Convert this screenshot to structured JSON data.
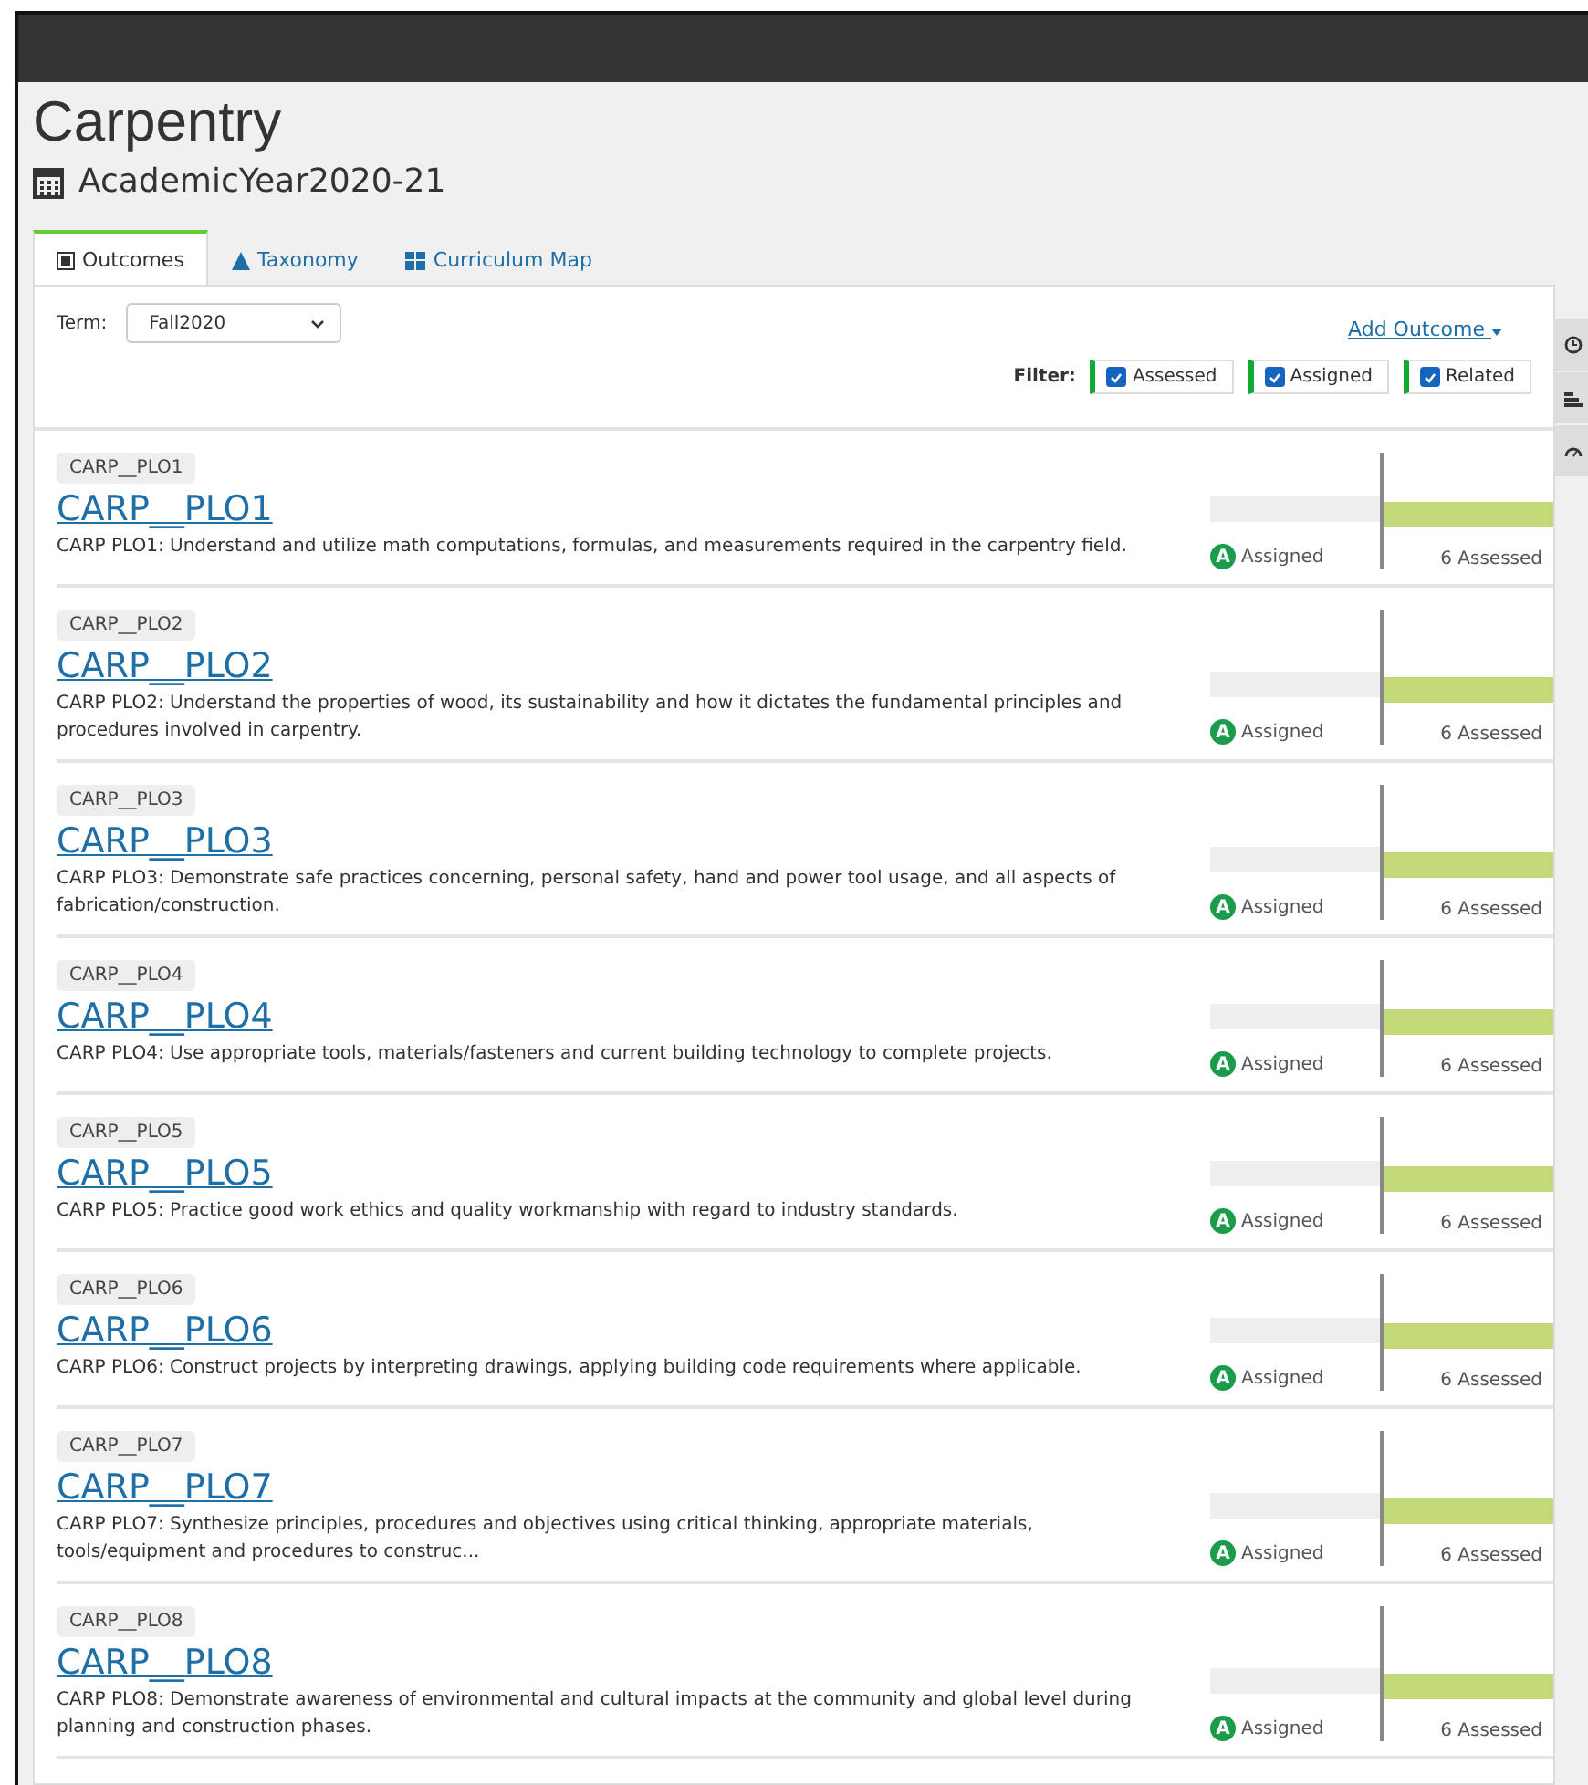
{
  "header": {
    "title": "Carpentry",
    "subtitle": "AcademicYear2020-21"
  },
  "tabs": [
    {
      "label": "Outcomes",
      "selected": true
    },
    {
      "label": "Taxonomy",
      "selected": false
    },
    {
      "label": "Curriculum Map",
      "selected": false
    }
  ],
  "term": {
    "label": "Term:",
    "value": "Fall2020"
  },
  "add_outcome": "Add Outcome",
  "filter": {
    "label": "Filter:",
    "options": [
      {
        "label": "Assessed",
        "checked": true
      },
      {
        "label": "Assigned",
        "checked": true
      },
      {
        "label": "Related",
        "checked": true
      }
    ]
  },
  "outcomes": [
    {
      "code": "CARP__PLO1",
      "title": "CARP__PLO1",
      "description": "CARP PLO1: Understand and utilize math computations, formulas, and measurements required in the carpentry field.",
      "badge": "A",
      "status": "Assigned",
      "assessed": "6 Assessed"
    },
    {
      "code": "CARP__PLO2",
      "title": "CARP__PLO2",
      "description": "CARP PLO2: Understand the properties of wood, its sustainability and how it dictates the fundamental principles and procedures involved in carpentry.",
      "badge": "A",
      "status": "Assigned",
      "assessed": "6 Assessed"
    },
    {
      "code": "CARP__PLO3",
      "title": "CARP__PLO3",
      "description": "CARP PLO3: Demonstrate safe practices concerning, personal safety, hand and power tool usage, and all aspects of fabrication/construction.",
      "badge": "A",
      "status": "Assigned",
      "assessed": "6 Assessed"
    },
    {
      "code": "CARP__PLO4",
      "title": "CARP__PLO4",
      "description": "CARP PLO4: Use appropriate tools, materials/fasteners and current building technology to complete projects.",
      "badge": "A",
      "status": "Assigned",
      "assessed": "6 Assessed"
    },
    {
      "code": "CARP__PLO5",
      "title": "CARP__PLO5",
      "description": "CARP PLO5: Practice good work ethics and quality workmanship with regard to industry standards.",
      "badge": "A",
      "status": "Assigned",
      "assessed": "6 Assessed"
    },
    {
      "code": "CARP__PLO6",
      "title": "CARP__PLO6",
      "description": "CARP PLO6: Construct projects by interpreting drawings, applying building code requirements where applicable.",
      "badge": "A",
      "status": "Assigned",
      "assessed": "6 Assessed"
    },
    {
      "code": "CARP__PLO7",
      "title": "CARP__PLO7",
      "description": "CARP PLO7: Synthesize principles, procedures and objectives using critical thinking, appropriate materials, tools/equipment and procedures to construc...",
      "badge": "A",
      "status": "Assigned",
      "assessed": "6 Assessed"
    },
    {
      "code": "CARP__PLO8",
      "title": "CARP__PLO8",
      "description": "CARP PLO8: Demonstrate awareness of environmental and cultural impacts at the community and global level during planning and construction phases.",
      "badge": "A",
      "status": "Assigned",
      "assessed": "6 Assessed"
    }
  ]
}
